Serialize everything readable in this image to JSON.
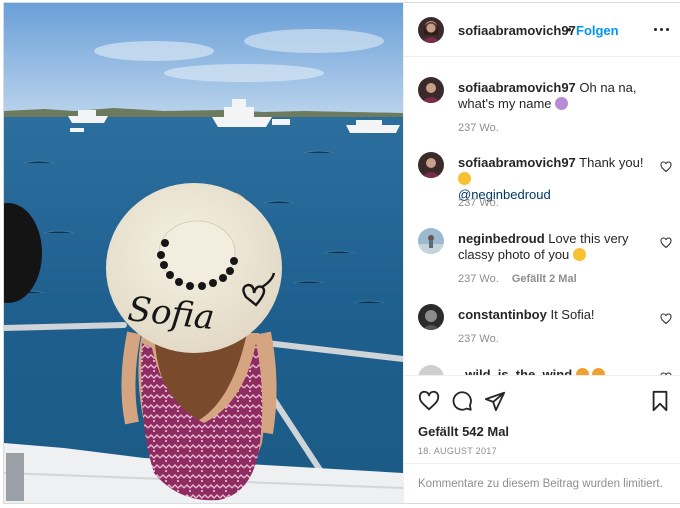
{
  "post": {
    "username": "sofiaabramovich97",
    "separator": "•",
    "follow_label": "Folgen",
    "hat_text": "Sofia"
  },
  "comments": [
    {
      "username": "sofiaabramovich97",
      "text": "Oh na na, what's my name",
      "emoji": "woman-gesturing-emoji",
      "time": "237 Wo.",
      "likes_label": "",
      "has_heart": false
    },
    {
      "username": "sofiaabramovich97",
      "text": "Thank you!",
      "emoji": "kissing-face-emoji",
      "mention": "@neginbedroud",
      "time": "237 Wo.",
      "likes_label": "",
      "has_heart": true
    },
    {
      "username": "neginbedroud",
      "text": "Love this very classy photo of you",
      "emoji": "kissing-face-emoji",
      "time": "237 Wo.",
      "likes_label": "Gefällt 2 Mal",
      "has_heart": true
    },
    {
      "username": "constantinboy",
      "text": "It Sofia!",
      "time": "237 Wo.",
      "likes_label": "",
      "has_heart": true
    },
    {
      "username": "_wild_is_the_wind",
      "text": "",
      "time": "",
      "likes_label": "",
      "has_heart": true
    }
  ],
  "actions": {
    "icons": [
      "heart-icon",
      "comment-icon",
      "share-icon",
      "bookmark-icon"
    ],
    "likes": "Gefällt 542 Mal",
    "date": "18. AUGUST 2017"
  },
  "footer": {
    "comments_disabled": "Kommentare zu diesem Beitrag wurden limitiert."
  },
  "colors": {
    "accent": "#0095f6",
    "text": "#262626",
    "muted": "#8e8e8e",
    "border": "#efefef"
  }
}
